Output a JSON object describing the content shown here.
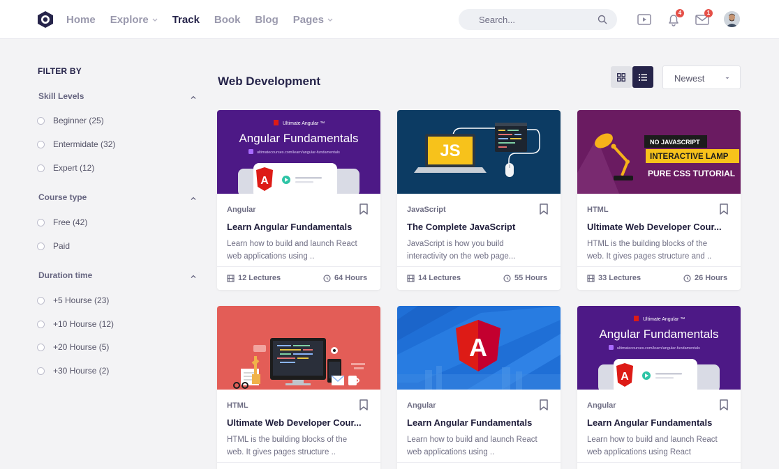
{
  "nav": {
    "items": [
      {
        "label": "Home",
        "active": false,
        "dropdown": false
      },
      {
        "label": "Explore",
        "active": false,
        "dropdown": true
      },
      {
        "label": "Track",
        "active": true,
        "dropdown": false
      },
      {
        "label": "Book",
        "active": false,
        "dropdown": false
      },
      {
        "label": "Blog",
        "active": false,
        "dropdown": false
      },
      {
        "label": "Pages",
        "active": false,
        "dropdown": true
      }
    ],
    "search_placeholder": "Search...",
    "notifications_count": "4",
    "messages_count": "1"
  },
  "filters": {
    "title": "FILTER BY",
    "groups": [
      {
        "title": "Skill Levels",
        "options": [
          "Beginner (25)",
          "Entermidate (32)",
          "Expert (12)"
        ]
      },
      {
        "title": "Course type",
        "options": [
          "Free (42)",
          "Paid"
        ]
      },
      {
        "title": "Duration time",
        "options": [
          "+5 Hourse (23)",
          "+10 Hourse (12)",
          "+20 Hourse (5)",
          "+30 Hourse (2)"
        ]
      }
    ]
  },
  "main": {
    "title": "Web Development",
    "sort_value": "Newest"
  },
  "thumb_text": {
    "angular_brand": "Ultimate Angular ™",
    "angular_title": "Angular Fundamentals",
    "angular_url": "ultimatecourses.com/learn/angular-fundamentals",
    "js": "JS",
    "lamp_1": "NO JAVASCRIPT",
    "lamp_2": "INTERACTIVE LAMP",
    "lamp_3": "PURE CSS TUTORIAL"
  },
  "courses": [
    {
      "category": "Angular",
      "title": "Learn Angular Fundamentals",
      "desc1": "Learn how to build and launch React",
      "desc2": "web applications using ..",
      "lectures": "12 Lectures",
      "hours": "64 Hours"
    },
    {
      "category": "JavaScript",
      "title": "The Complete JavaScript",
      "desc1": "JavaScript is how you build",
      "desc2": "interactivity on the web page...",
      "lectures": "14 Lectures",
      "hours": "55 Hours"
    },
    {
      "category": "HTML",
      "title": "Ultimate Web Developer Cour...",
      "desc1": "HTML is the building blocks of the",
      "desc2": "web. It gives pages structure and ..",
      "lectures": "33 Lectures",
      "hours": "26 Hours"
    },
    {
      "category": "HTML",
      "title": "Ultimate Web Developer Cour...",
      "desc1": "HTML is the building blocks of the",
      "desc2": "web. It gives pages structure ..",
      "lectures": "",
      "hours": ""
    },
    {
      "category": "Angular",
      "title": "Learn Angular Fundamentals",
      "desc1": "Learn how to build and launch React",
      "desc2": "web applications using ..",
      "lectures": "",
      "hours": ""
    },
    {
      "category": "Angular",
      "title": "Learn Angular Fundamentals",
      "desc1": "Learn how to build and launch React",
      "desc2": "web applications using React",
      "lectures": "",
      "hours": ""
    }
  ],
  "colors": {
    "primary": "#26244a",
    "badge": "#e55048",
    "angular_bg": "#4d1986",
    "js_bg": "#0c3b63",
    "lamp_bg": "#6a1b61",
    "html_bg": "#e35d57",
    "angular_blue_bg": "#1f6fd6"
  }
}
